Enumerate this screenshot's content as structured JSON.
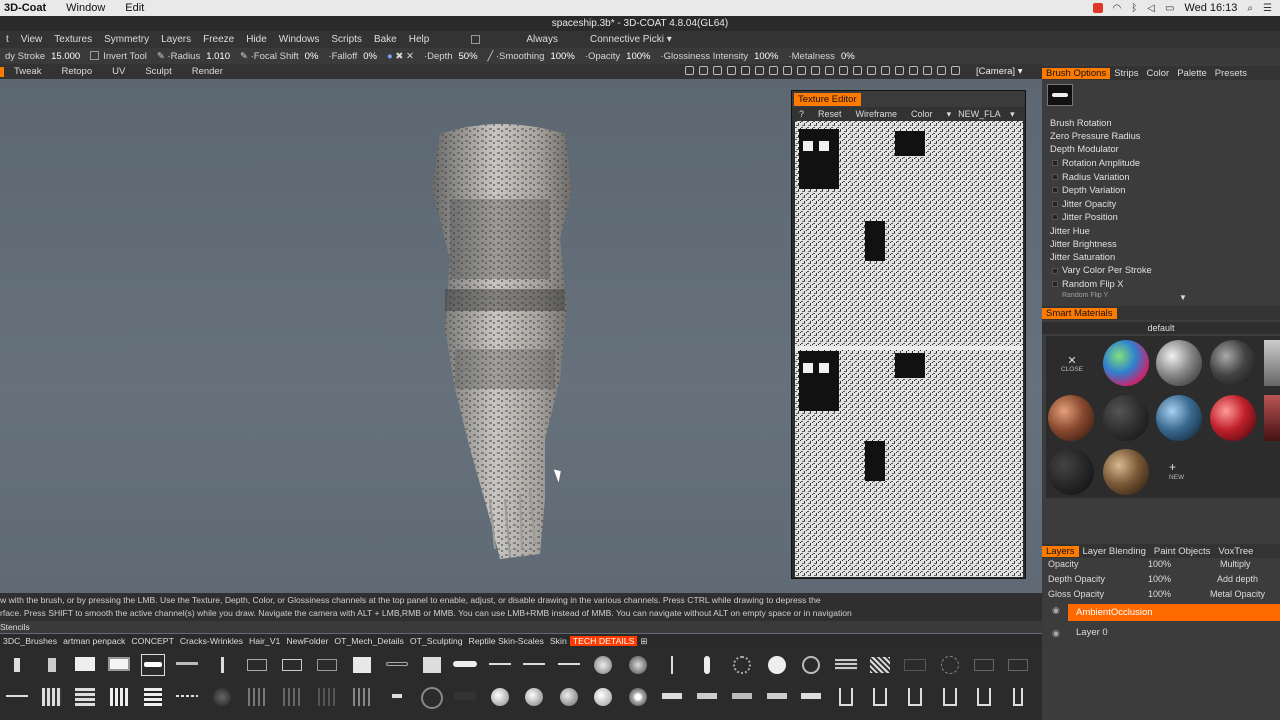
{
  "menubar": {
    "app": "3D-Coat",
    "items": [
      "Window",
      "Edit"
    ],
    "clock": "Wed 16:13"
  },
  "window_title": "spaceship.3b* - 3D-COAT 4.8.04(GL64)",
  "main_menu": [
    "t",
    "View",
    "Textures",
    "Symmetry",
    "Layers",
    "Freeze",
    "Hide",
    "Windows",
    "Scripts",
    "Bake",
    "Help"
  ],
  "always_label": "Always",
  "connective_label": "Connective Picki",
  "params": {
    "stroke_label": "dy Stroke",
    "stroke_value": "15.000",
    "invert_label": "Invert",
    "tool_label": "Tool",
    "radius_label": "Radius",
    "radius_value": "1.010",
    "focal_label": "Focal Shift",
    "focal_value": "0%",
    "falloff_label": "Falloff",
    "falloff_value": "0%",
    "depth_label": "Depth",
    "depth_value": "50%",
    "smoothing_label": "Smoothing",
    "smoothing_value": "100%",
    "opacity_label": "Opacity",
    "opacity_value": "100%",
    "gloss_label": "Glossiness Intensity",
    "gloss_value": "100%",
    "metal_label": "Metalness",
    "metal_value": "0%"
  },
  "rooms": [
    "Tweak",
    "Retopo",
    "UV",
    "Sculpt",
    "Render"
  ],
  "camera_label": "[Camera]",
  "texture_editor": {
    "title": "Texture Editor",
    "toolbar": [
      "?",
      "Reset",
      "Wireframe",
      "Color",
      "NEW_FLA"
    ]
  },
  "brush_tabs": [
    "Brush Options",
    "Strips",
    "Color",
    "Palette",
    "Presets"
  ],
  "brush_options": [
    "Brush Rotation",
    "Zero Pressure Radius",
    "Depth Modulator",
    "Rotation Amplitude",
    "Radius Variation",
    "Depth Variation",
    "Jitter Opacity",
    "Jitter Position",
    "Jitter Hue",
    "Jitter Brightness",
    "Jitter Saturation",
    "Vary Color Per Stroke",
    "Random Flip X",
    "Random Flip Y"
  ],
  "smart_materials": {
    "title": "Smart Materials",
    "folder": "default",
    "close_label": "CLOSE",
    "new_label": "NEW"
  },
  "layer_tabs": [
    "Layers",
    "Layer Blending",
    "Paint Objects",
    "VoxTree"
  ],
  "layer_props": [
    {
      "label": "Opacity",
      "value": "100%",
      "mode": "Multiply"
    },
    {
      "label": "Depth Opacity",
      "value": "100%",
      "mode": "Add depth"
    },
    {
      "label": "Gloss Opacity",
      "value": "100%",
      "mode": "Metal Opacity"
    }
  ],
  "layers": [
    "AmbientOcclusion",
    "Layer 0"
  ],
  "hint_lines": [
    "w with the brush, or by pressing the LMB. Use the Texture, Depth, Color, or Glossiness channels at the top panel to enable, adjust, or disable drawing in the various channels. Press CTRL while drawing to depress the",
    "rface. Press SHIFT to smooth the active channel(s) while you draw. Navigate the camera with ALT + LMB,RMB or MMB. You can use LMB+RMB instead of MMB. You can navigate without ALT on empty space or in navigation"
  ],
  "stencils_label": "Stencils",
  "presets": [
    "3DC_Brushes",
    "artman penpack",
    "CONCEPT",
    "Cracks-Wrinkles",
    "Hair_V1",
    "NewFolder",
    "OT_Mech_Details",
    "OT_Sculpting",
    "Reptile Skin-Scales",
    "Skin",
    "TECH DETAILS"
  ],
  "colors": {
    "accent": "#ff7b00",
    "active_preset": "#ff3b00"
  }
}
